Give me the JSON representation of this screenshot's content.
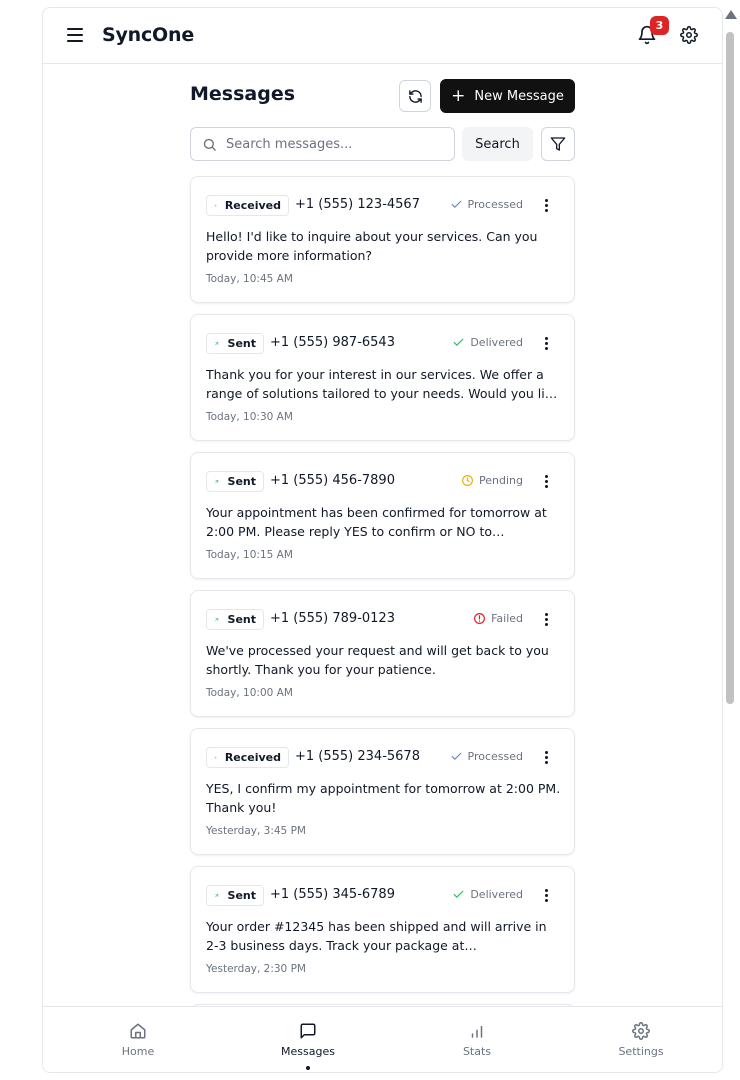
{
  "header": {
    "app_title": "SyncOne",
    "notification_count": "3"
  },
  "toolbar": {
    "title": "Messages",
    "new_message_label": "New Message",
    "search_placeholder": "Search messages...",
    "search_button_label": "Search"
  },
  "messages": [
    {
      "direction": "Received",
      "phone": "+1 (555) 123-4567",
      "status": "Processed",
      "status_color": "#6b8cc7",
      "text": "Hello! I'd like to inquire about your services. Can you provide more information?",
      "time": "Today, 10:45 AM"
    },
    {
      "direction": "Sent",
      "phone": "+1 (555) 987-6543",
      "status": "Delivered",
      "status_color": "#22c55e",
      "text": "Thank you for your interest in our services. We offer a range of solutions tailored to your needs. Would you like to schedule a consultation?",
      "time": "Today, 10:30 AM"
    },
    {
      "direction": "Sent",
      "phone": "+1 (555) 456-7890",
      "status": "Pending",
      "status_color": "#eab308",
      "text": "Your appointment has been confirmed for tomorrow at 2:00 PM. Please reply YES to confirm or NO to reschedule.",
      "time": "Today, 10:15 AM"
    },
    {
      "direction": "Sent",
      "phone": "+1 (555) 789-0123",
      "status": "Failed",
      "status_color": "#dc2626",
      "text": "We've processed your request and will get back to you shortly. Thank you for your patience.",
      "time": "Today, 10:00 AM"
    },
    {
      "direction": "Received",
      "phone": "+1 (555) 234-5678",
      "status": "Processed",
      "status_color": "#6b8cc7",
      "text": "YES, I confirm my appointment for tomorrow at 2:00 PM. Thank you!",
      "time": "Yesterday, 3:45 PM"
    },
    {
      "direction": "Sent",
      "phone": "+1 (555) 345-6789",
      "status": "Delivered",
      "status_color": "#22c55e",
      "text": "Your order #12345 has been shipped and will arrive in 2-3 business days. Track your package at example.com/track.",
      "time": "Yesterday, 2:30 PM"
    }
  ],
  "bottom_nav": {
    "home": "Home",
    "messages": "Messages",
    "stats": "Stats",
    "settings": "Settings",
    "active": "messages"
  },
  "icons": {
    "received": "arrow-down-right-icon",
    "sent": "arrow-up-right-icon",
    "processed": "check-icon",
    "delivered": "check-icon",
    "pending": "clock-icon",
    "failed": "alert-circle-icon"
  },
  "colors": {
    "primary_button": "#111111",
    "badge": "#dc2626",
    "received_arrow": "#4f6bd6",
    "sent_arrow": "#22c55e"
  }
}
